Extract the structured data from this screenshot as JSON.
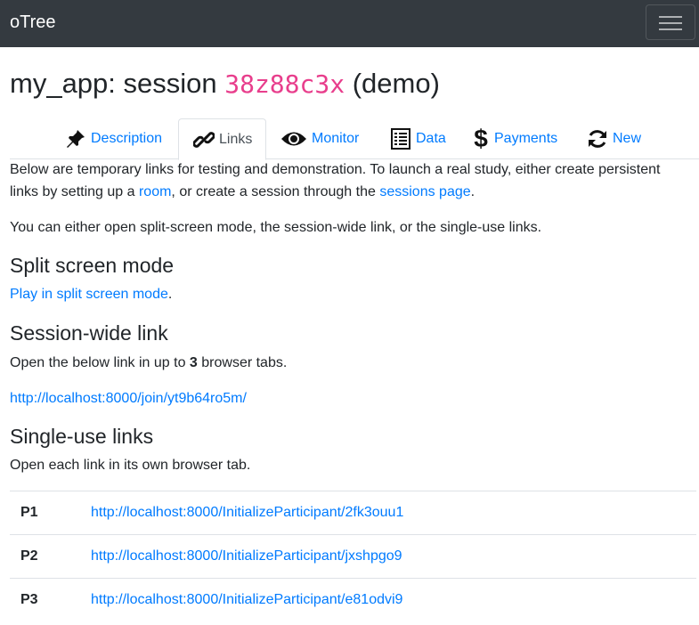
{
  "navbar": {
    "brand": "oTree"
  },
  "title": {
    "prefix": "my_app: session ",
    "code": "38z88c3x",
    "suffix": " (demo)"
  },
  "tabs": [
    {
      "label": "Description",
      "icon": "pushpin-icon"
    },
    {
      "label": "Links",
      "icon": "link-icon"
    },
    {
      "label": "Monitor",
      "icon": "eye-icon"
    },
    {
      "label": "Data",
      "icon": "list-table-icon"
    },
    {
      "label": "Payments",
      "icon": "dollar-icon"
    },
    {
      "label": "New",
      "icon": "refresh-icon"
    }
  ],
  "active_tab": "Links",
  "intro": {
    "line1": "Below are temporary links for testing and demonstration. To launch a real study, either create persistent",
    "line2_pre": "links by setting up a ",
    "room_link": "room",
    "line2_mid": ", or create a session through the ",
    "sessions_link": "sessions page",
    "line2_end": "."
  },
  "choice_text": "You can either open split-screen mode, the session-wide link, or the single-use links.",
  "split": {
    "heading": "Split screen mode",
    "link": "Play in split screen mode",
    "after": "."
  },
  "session_wide": {
    "heading": "Session-wide link",
    "text_pre": "Open the below link in up to ",
    "count": "3",
    "text_post": " browser tabs.",
    "url": "http://localhost:8000/join/yt9b64ro5m/"
  },
  "single_use": {
    "heading": "Single-use links",
    "text": "Open each link in its own browser tab.",
    "rows": [
      {
        "label": "P1",
        "url": "http://localhost:8000/InitializeParticipant/2fk3ouu1"
      },
      {
        "label": "P2",
        "url": "http://localhost:8000/InitializeParticipant/jxshpgo9"
      },
      {
        "label": "P3",
        "url": "http://localhost:8000/InitializeParticipant/e81odvi9"
      }
    ]
  },
  "colors": {
    "navbar": "#343a40",
    "link": "#007bff",
    "code": "#e83e8c",
    "border": "#dee2e6"
  }
}
